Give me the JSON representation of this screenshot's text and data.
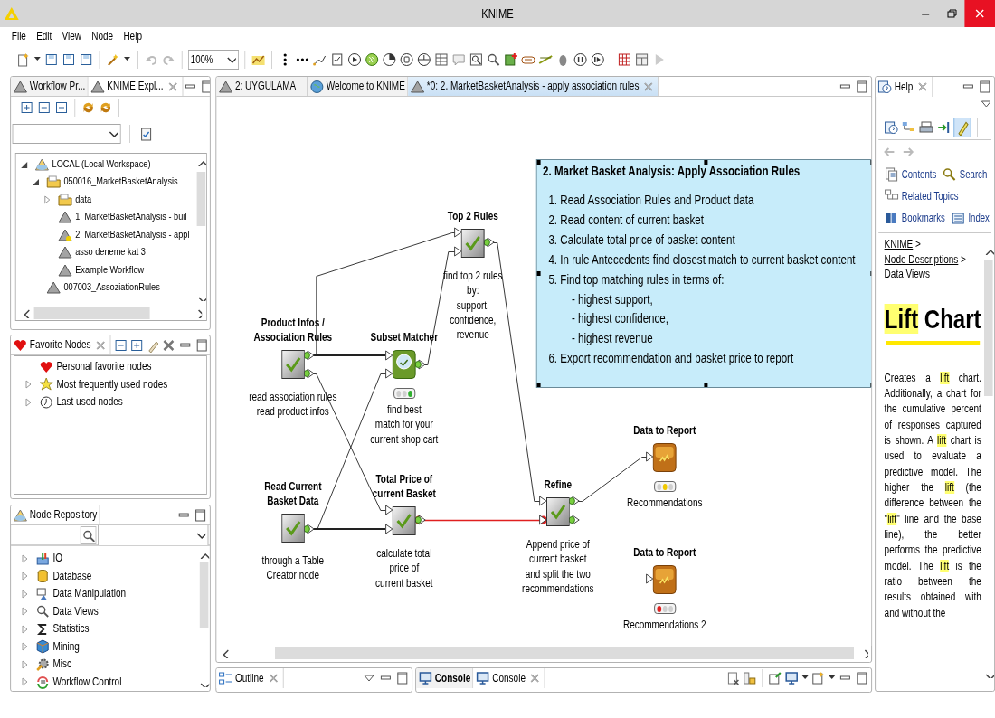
{
  "window": {
    "title": "KNIME"
  },
  "menu": [
    "File",
    "Edit",
    "View",
    "Node",
    "Help"
  ],
  "toolbar": {
    "zoom": "100%"
  },
  "explorer": {
    "tabs": [
      {
        "label": "Workflow Pr...",
        "selected": false
      },
      {
        "label": "KNIME Expl...",
        "selected": true
      }
    ],
    "tree": [
      {
        "label": "LOCAL (Local Workspace)",
        "kind": "mount",
        "expanded": true,
        "children": [
          {
            "label": "050016_MarketBasketAnalysis",
            "kind": "folder",
            "expanded": true,
            "children": [
              {
                "label": "data",
                "kind": "folder",
                "expanded": false
              },
              {
                "label": "1. MarketBasketAnalysis - buil",
                "kind": "workflow",
                "open": false
              },
              {
                "label": "2. MarketBasketAnalysis - appl",
                "kind": "workflow",
                "open": true
              },
              {
                "label": "asso deneme kat 3",
                "kind": "workflow",
                "open": false
              },
              {
                "label": "Example Workflow",
                "kind": "workflow",
                "open": false
              }
            ]
          },
          {
            "label": "007003_AssoziationRules",
            "kind": "workflow",
            "open": false
          }
        ]
      }
    ]
  },
  "favorites": {
    "title": "Favorite Nodes",
    "items": [
      {
        "label": "Personal favorite nodes",
        "kind": "heart"
      },
      {
        "label": "Most frequently used nodes",
        "kind": "star",
        "expanded": false
      },
      {
        "label": "Last used nodes",
        "kind": "clock",
        "expanded": false
      }
    ]
  },
  "repository": {
    "title": "Node Repository",
    "items": [
      {
        "label": "IO",
        "kind": "io",
        "expanded": false
      },
      {
        "label": "Database",
        "kind": "database",
        "expanded": false
      },
      {
        "label": "Data Manipulation",
        "kind": "manipulation",
        "expanded": false
      },
      {
        "label": "Data Views",
        "kind": "views",
        "expanded": false
      },
      {
        "label": "Statistics",
        "kind": "sigma",
        "expanded": false
      },
      {
        "label": "Mining",
        "kind": "cube",
        "expanded": false
      },
      {
        "label": "Misc",
        "kind": "gear",
        "expanded": false
      },
      {
        "label": "Workflow Control",
        "kind": "loop",
        "expanded": false
      }
    ]
  },
  "editor": {
    "tabs": [
      {
        "label": "2: UYGULAMA",
        "kind": "workflow",
        "selected": false
      },
      {
        "label": "Welcome to KNIME",
        "kind": "globe",
        "selected": false
      },
      {
        "label": "*0: 2. MarketBasketAnalysis - apply association rules",
        "kind": "workflow",
        "selected": true
      }
    ],
    "annotation": {
      "title": "2. Market Basket Analysis: Apply Association Rules",
      "lines": [
        {
          "text": "1. Read Association Rules and Product data",
          "kind": "step"
        },
        {
          "text": "2. Read content of current basket",
          "kind": "step"
        },
        {
          "text": "3. Calculate total price of basket content",
          "kind": "step"
        },
        {
          "text": "4. In rule Antecedents find closest match to current basket content",
          "kind": "step"
        },
        {
          "text": "5. Find top matching rules in terms of:",
          "kind": "step"
        },
        {
          "text": "- highest support,",
          "kind": "sub"
        },
        {
          "text": "- highest confidence,",
          "kind": "sub"
        },
        {
          "text": "- highest revenue",
          "kind": "sub"
        },
        {
          "text": "6. Export recommendation and basket price to report",
          "kind": "step"
        }
      ]
    },
    "nodes": [
      {
        "kind": "metanode",
        "title": "Product Infos /\nAssociation Rules",
        "description": "read association rules\nread product infos"
      },
      {
        "kind": "matcher",
        "title": "Subset Matcher",
        "lights": [
          {
            "on": false
          },
          {
            "on": false
          },
          {
            "on": true
          }
        ],
        "description": "find best\nmatch for your\ncurrent shop cart"
      },
      {
        "kind": "metanode",
        "title": "Top 2 Rules",
        "description": "find top 2 rules\nby:\nsupport,\nconfidence,\nrevenue"
      },
      {
        "kind": "metanode",
        "title": "Read Current\nBasket Data",
        "description": "through a Table\nCreator node"
      },
      {
        "kind": "metanode",
        "title": "Total Price of\ncurrent Basket",
        "description": "calculate total\nprice of\ncurrent basket"
      },
      {
        "kind": "metanode",
        "title": "Refine",
        "description": "Append price of\ncurrent basket\nand split the two\nrecommendations"
      },
      {
        "kind": "report",
        "title": "Data to Report",
        "lights": [
          {
            "on": false
          },
          {
            "on": true
          },
          {
            "on": false
          }
        ],
        "description": "Recommendations"
      },
      {
        "kind": "report",
        "title": "Data to Report",
        "lights": [
          {
            "on": true
          },
          {
            "on": false
          },
          {
            "on": false
          }
        ],
        "description": "Recommendations 2"
      }
    ],
    "connections": [
      {
        "kind": "data"
      },
      {
        "kind": "data"
      },
      {
        "kind": "data"
      },
      {
        "kind": "data"
      },
      {
        "kind": "data"
      },
      {
        "kind": "data"
      },
      {
        "kind": "data"
      },
      {
        "kind": "variable"
      },
      {
        "kind": "data"
      }
    ]
  },
  "outline": {
    "tab": "Outline"
  },
  "console": {
    "tabs": [
      {
        "label": "Console",
        "changed": true,
        "selected": false
      },
      {
        "label": "Console",
        "changed": false,
        "selected": true
      }
    ]
  },
  "help": {
    "tab": "Help",
    "highlight_toggle": {
      "on": true
    },
    "links": [
      [
        "Contents",
        "Search"
      ],
      [
        "Related Topics"
      ],
      [
        "Bookmarks",
        "Index"
      ]
    ],
    "breadcrumb": [
      {
        "text": "KNIME",
        "link": true
      },
      {
        "text": ">",
        "link": false
      },
      {
        "text": "Node Descriptions",
        "link": true
      },
      {
        "text": ">",
        "link": false
      },
      {
        "text": "Data Views",
        "link": true
      }
    ],
    "heading": [
      {
        "text": "Lift",
        "highlighted": true
      },
      {
        "text": " Chart",
        "highlighted": false
      }
    ],
    "body": [
      {
        "text": "Creates a ",
        "highlighted": false
      },
      {
        "text": "lift",
        "highlighted": true
      },
      {
        "text": " chart. Additionally, a chart for the cumulative percent of responses captured is shown. A ",
        "highlighted": false
      },
      {
        "text": "lift",
        "highlighted": true
      },
      {
        "text": " chart is used to evaluate a predictive model. The higher the ",
        "highlighted": false
      },
      {
        "text": "lift",
        "highlighted": true
      },
      {
        "text": " (the difference between the \"",
        "highlighted": false
      },
      {
        "text": "lift",
        "highlighted": true
      },
      {
        "text": "\" line and the base line), the better performs the predictive model. The ",
        "highlighted": false
      },
      {
        "text": "lift",
        "highlighted": true
      },
      {
        "text": " is the ratio between the results obtained with and without the",
        "highlighted": false
      }
    ]
  }
}
